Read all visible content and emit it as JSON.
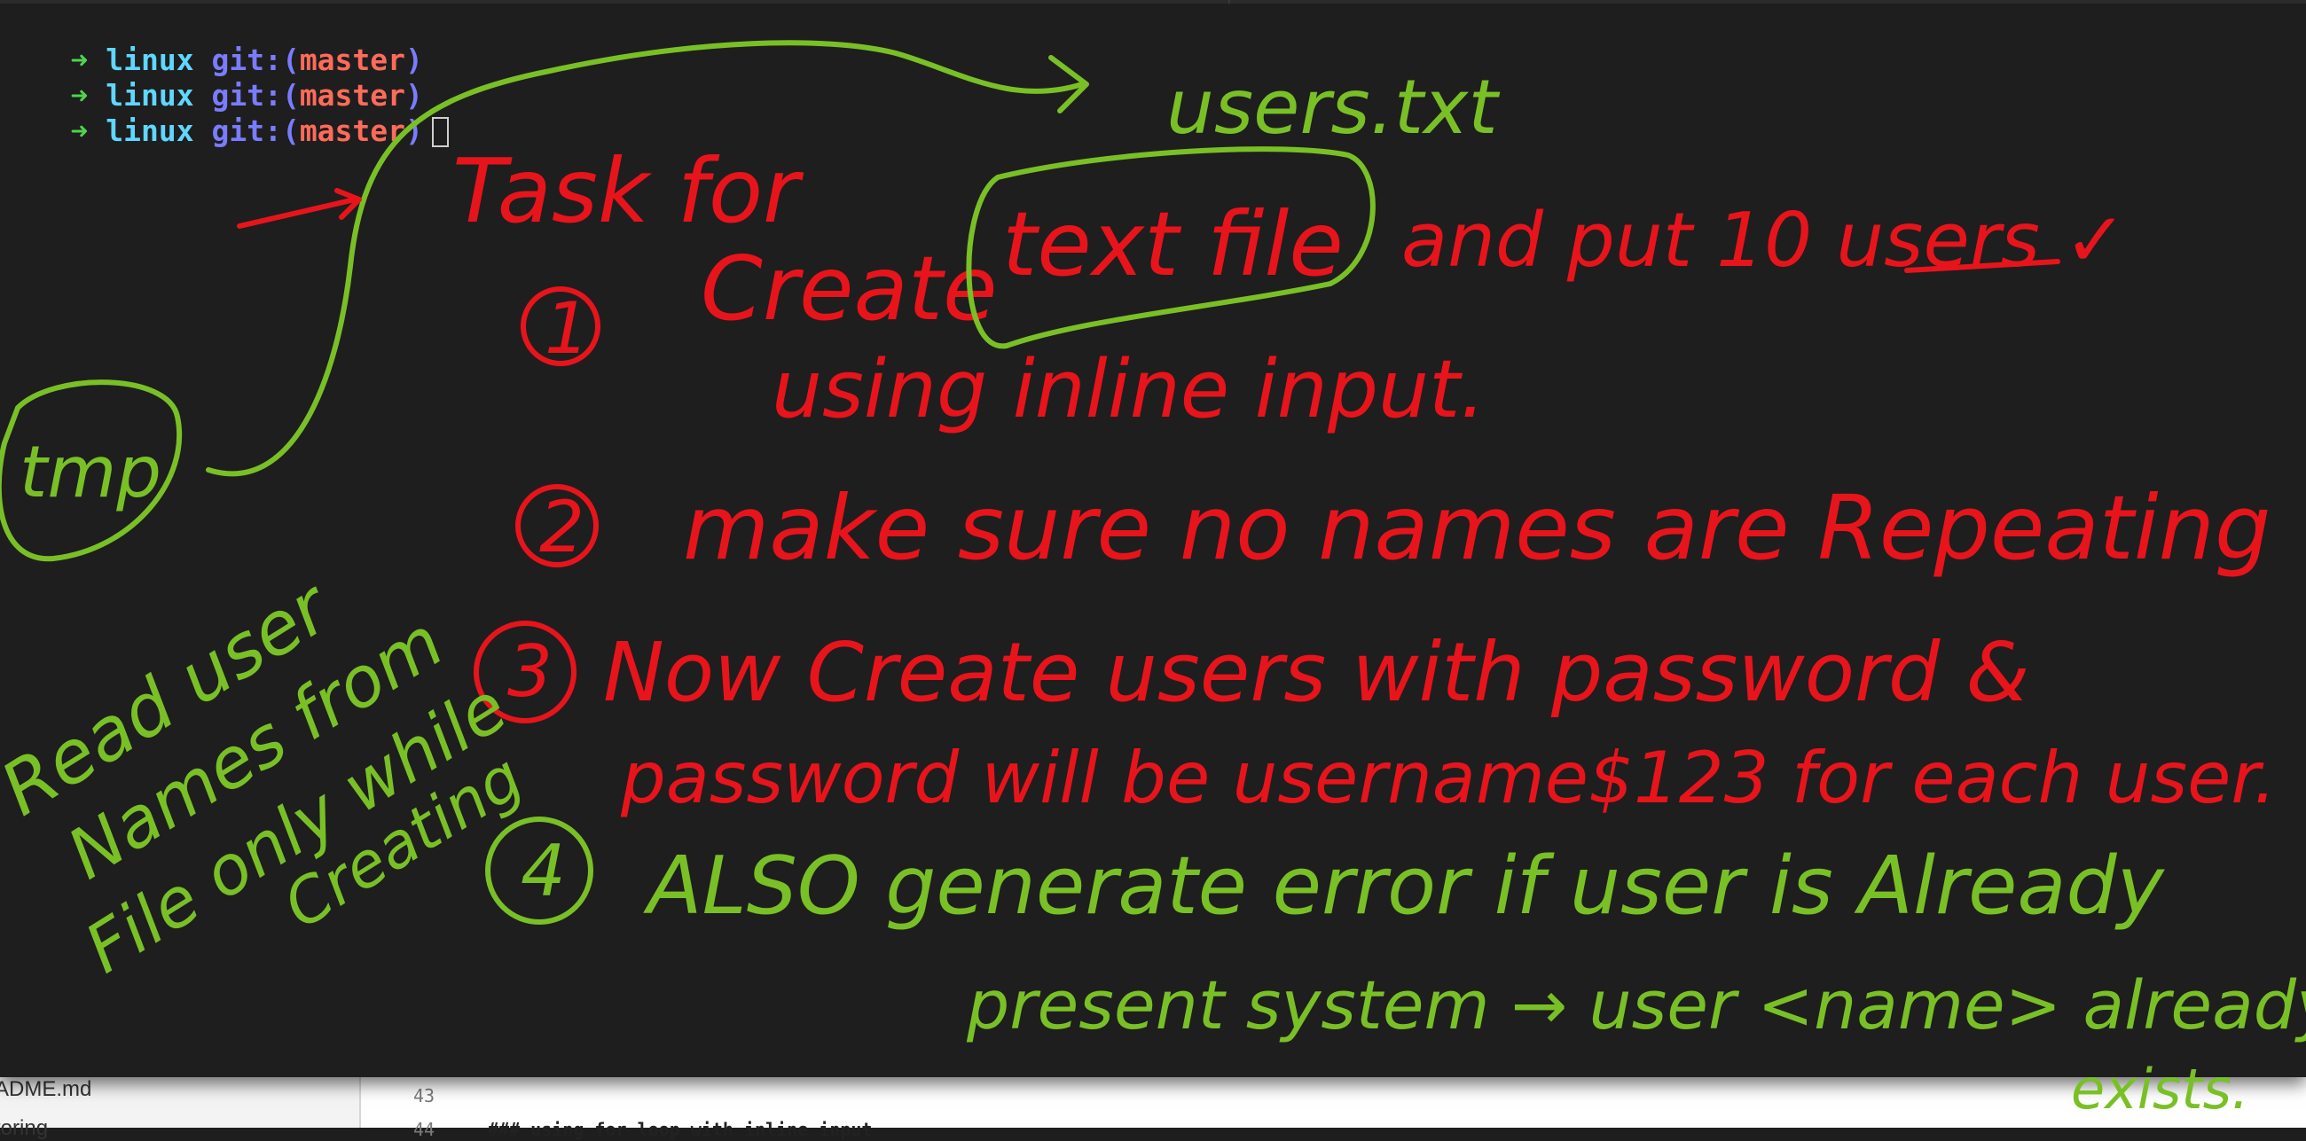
{
  "terminal": {
    "prompts": [
      {
        "arrow": "➜",
        "dir": "linux",
        "git": "git:",
        "open": "(",
        "branch": "master",
        "close": ")"
      },
      {
        "arrow": "➜",
        "dir": "linux",
        "git": "git:",
        "open": "(",
        "branch": "master",
        "close": ")"
      },
      {
        "arrow": "➜",
        "dir": "linux",
        "git": "git:",
        "open": "(",
        "branch": "master",
        "close": ")"
      }
    ]
  },
  "editor": {
    "sidebar_file": "ADME.md",
    "sidebar_file_2": "toring",
    "line_numbers": [
      "43",
      "44"
    ],
    "code_line_44": "### using for loop with inline input"
  },
  "annotations": {
    "colors": {
      "red": "#e8141b",
      "green": "#79c026"
    },
    "users_file": "users.txt",
    "task_heading": "Task for",
    "tmp_box": "tmp",
    "items": [
      {
        "num": "1",
        "lines": [
          "Create",
          "text file",
          "and put 10 users ✓",
          "using inline input."
        ]
      },
      {
        "num": "2",
        "lines": [
          "make sure no names are Repeating"
        ]
      },
      {
        "num": "3",
        "lines": [
          "Now Create users with password &",
          "password will be username$123 for each user."
        ]
      },
      {
        "num": "4",
        "lines": [
          "ALSO generate error if user is Already",
          "present system → user <name> already",
          "exists."
        ]
      }
    ],
    "side_note": [
      "Read user",
      "Names from",
      "File only while",
      "Creating"
    ]
  }
}
